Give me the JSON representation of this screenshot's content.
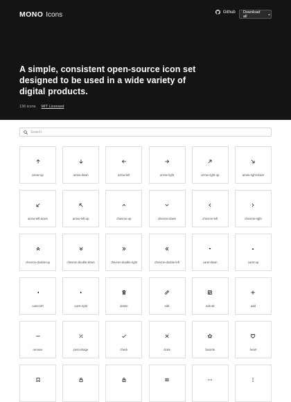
{
  "header": {
    "logo_mark": "MONO",
    "logo_text": "Icons",
    "github_label": "Github",
    "download_label": "Download all"
  },
  "hero": {
    "headline": "A simple, consistent open-source icon set designed to be used in a wide variety of digital products.",
    "icon_count": "136 icons",
    "license": "MIT Licensed"
  },
  "search": {
    "placeholder": "Search"
  },
  "icons": [
    {
      "label": "arrow-up",
      "icon": "arrow-up"
    },
    {
      "label": "arrow-down",
      "icon": "arrow-down"
    },
    {
      "label": "arrow-left",
      "icon": "arrow-left"
    },
    {
      "label": "arrow-right",
      "icon": "arrow-right"
    },
    {
      "label": "arrow-right-up",
      "icon": "arrow-right-up"
    },
    {
      "label": "arrow-right-down",
      "icon": "arrow-right-down"
    },
    {
      "label": "arrow-left-down",
      "icon": "arrow-left-down"
    },
    {
      "label": "arrow-left-up",
      "icon": "arrow-left-up"
    },
    {
      "label": "chevron-up",
      "icon": "chevron-up"
    },
    {
      "label": "chevron-down",
      "icon": "chevron-down"
    },
    {
      "label": "chevron-left",
      "icon": "chevron-left"
    },
    {
      "label": "chevron-right",
      "icon": "chevron-right"
    },
    {
      "label": "chevron-double-up",
      "icon": "chevron-double-up"
    },
    {
      "label": "chevron-double-down",
      "icon": "chevron-double-down"
    },
    {
      "label": "chevron-double-right",
      "icon": "chevron-double-right"
    },
    {
      "label": "chevron-double-left",
      "icon": "chevron-double-left"
    },
    {
      "label": "caret-down",
      "icon": "caret-down"
    },
    {
      "label": "caret-up",
      "icon": "caret-up"
    },
    {
      "label": "caret-left",
      "icon": "caret-left"
    },
    {
      "label": "caret-right",
      "icon": "caret-right"
    },
    {
      "label": "delete",
      "icon": "delete"
    },
    {
      "label": "edit",
      "icon": "edit"
    },
    {
      "label": "edit-alt",
      "icon": "edit-alt"
    },
    {
      "label": "add",
      "icon": "add"
    },
    {
      "label": "remove",
      "icon": "remove"
    },
    {
      "label": "percentage",
      "icon": "percentage"
    },
    {
      "label": "check",
      "icon": "check"
    },
    {
      "label": "close",
      "icon": "close"
    },
    {
      "label": "favorite",
      "icon": "favorite"
    },
    {
      "label": "heart",
      "icon": "heart"
    },
    {
      "label": "",
      "icon": "bookmark"
    },
    {
      "label": "",
      "icon": "lock"
    },
    {
      "label": "",
      "icon": "lock-alt"
    },
    {
      "label": "",
      "icon": "menu"
    },
    {
      "label": "",
      "icon": "more-horizontal"
    },
    {
      "label": "",
      "icon": "more-vertical"
    }
  ],
  "colors": {
    "hero_bg": "#141414",
    "tile_border": "#dedede"
  }
}
